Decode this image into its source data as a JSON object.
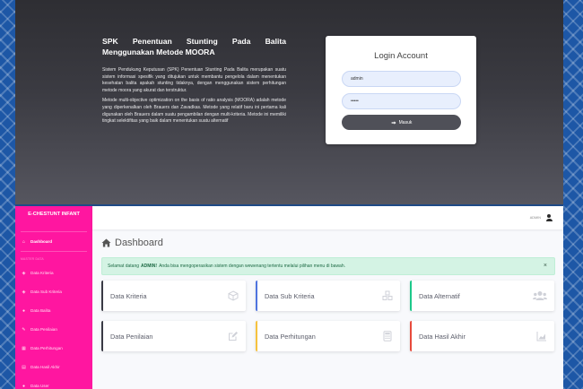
{
  "login_info": {
    "heading": "SPK Penentuan Stunting Pada Balita Menggunakan Metode MOORA",
    "paragraph1": "Sistem Pendukung Keputusan (SPK) Penentuan Stunting Pada Balita merupakan suatu sistem informasi spesifik yang ditujukan untuk membantu pengelola dalam menentukan kesehatan balita apakah stunting tidaknya, dengan menggunakan sistem perhitungan metode moora yang akurat dan terstruktur.",
    "paragraph2": "Metode multi-objective optimization on the basis of ratio analysis (MOORA) adalah metode yang diperkenalkan oleh Brauers dan Zavadkas. Metode yang relatif baru ini pertama kali digunakan oleh Brauers dalam suatu pengambilan dengan multi-kriteria. Metode ini memiliki tingkat selektifitas yang baik dalam menentukan suatu alternatif"
  },
  "login_card": {
    "title": "Login Account",
    "username_value": "admin",
    "password_value": "•••••",
    "submit_label": "Masuk"
  },
  "sidebar": {
    "brand": "E-CHESTUNT INFANT",
    "dashboard_label": "Dashboard",
    "section_heading": "MASTER DATA",
    "items": [
      {
        "label": "Data Kriteria",
        "icon": "cube-icon"
      },
      {
        "label": "Data Sub Kriteria",
        "icon": "cubes-icon"
      },
      {
        "label": "Data Balita",
        "icon": "users-icon"
      },
      {
        "label": "Data Penilaian",
        "icon": "edit-icon"
      },
      {
        "label": "Data Perhitungan",
        "icon": "calculator-icon"
      },
      {
        "label": "Data Hasil Akhir",
        "icon": "chart-icon"
      },
      {
        "label": "Data User",
        "icon": "user-icon"
      }
    ]
  },
  "topbar": {
    "username": "ADMIN"
  },
  "page": {
    "title": "Dashboard",
    "alert_prefix": "Selamat datang",
    "alert_user": "ADMIN!",
    "alert_suffix": "Anda bisa mengoperasikan sistem dengan wewenang tertentu melalui pilihan menu di bawah.",
    "alert_close": "×"
  },
  "cards": [
    {
      "label": "Data Kriteria",
      "icon": "cube-icon"
    },
    {
      "label": "Data Sub Kriteria",
      "icon": "cubes-icon"
    },
    {
      "label": "Data Alternatif",
      "icon": "users-icon"
    },
    {
      "label": "Data Penilaian",
      "icon": "edit-icon"
    },
    {
      "label": "Data Perhitungan",
      "icon": "calculator-icon"
    },
    {
      "label": "Data Hasil Akhir",
      "icon": "chart-icon"
    }
  ],
  "colors": {
    "sidebar": "#ff16a0",
    "login_button": "#4f5058",
    "alert_bg": "#d4f3e4",
    "card_accent_blue": "#4e73df",
    "card_accent_green": "#1cc88a",
    "card_accent_yellow": "#f6c23e",
    "card_accent_red": "#e74a3b"
  }
}
